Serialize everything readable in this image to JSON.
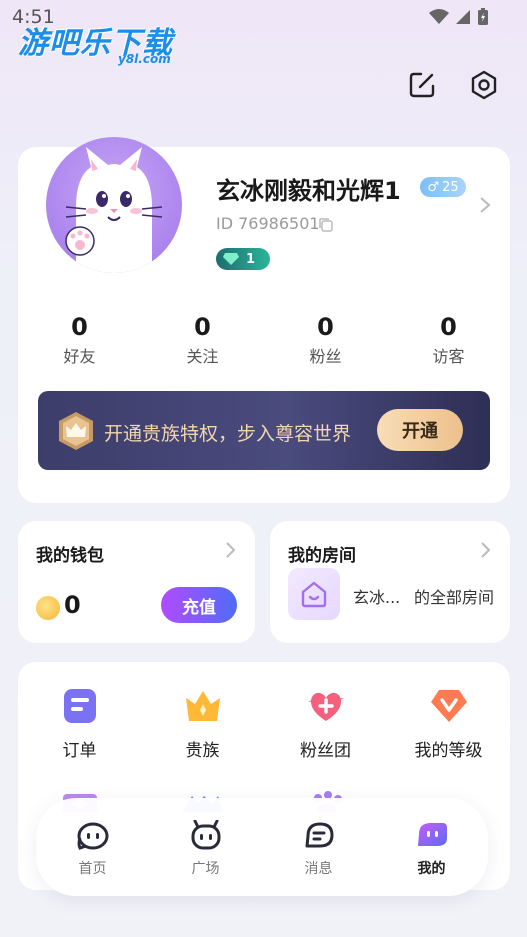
{
  "status_bar": {
    "time": "4:51"
  },
  "watermark": {
    "main": "游吧乐下载",
    "sub": "y8l.com"
  },
  "profile": {
    "username": "玄冰刚毅和光辉1",
    "gender_symbol": "♂",
    "age": "25",
    "user_id": "ID 76986501",
    "level": "1",
    "stats": [
      {
        "value": "0",
        "label": "好友"
      },
      {
        "value": "0",
        "label": "关注"
      },
      {
        "value": "0",
        "label": "粉丝"
      },
      {
        "value": "0",
        "label": "访客"
      }
    ]
  },
  "noble_banner": {
    "text": "开通贵族特权，步入尊容世界",
    "button": "开通"
  },
  "wallet": {
    "title": "我的钱包",
    "coins": "0",
    "recharge": "充值"
  },
  "room": {
    "title": "我的房间",
    "owner": "玄冰...",
    "suffix": "的全部房间"
  },
  "menu": {
    "items": [
      {
        "label": "订单",
        "icon": "order-icon"
      },
      {
        "label": "贵族",
        "icon": "crown-icon"
      },
      {
        "label": "粉丝团",
        "icon": "fan-club-icon"
      },
      {
        "label": "我的等级",
        "icon": "level-icon"
      }
    ]
  },
  "tabs": [
    {
      "label": "首页",
      "icon": "home-icon"
    },
    {
      "label": "广场",
      "icon": "square-icon"
    },
    {
      "label": "消息",
      "icon": "message-icon"
    },
    {
      "label": "我的",
      "icon": "profile-icon",
      "active": true
    }
  ],
  "colors": {
    "accent": "#8f5cf0",
    "recharge_start": "#b24bff",
    "recharge_end": "#4f6cf7",
    "banner": "#3d3d6a"
  }
}
